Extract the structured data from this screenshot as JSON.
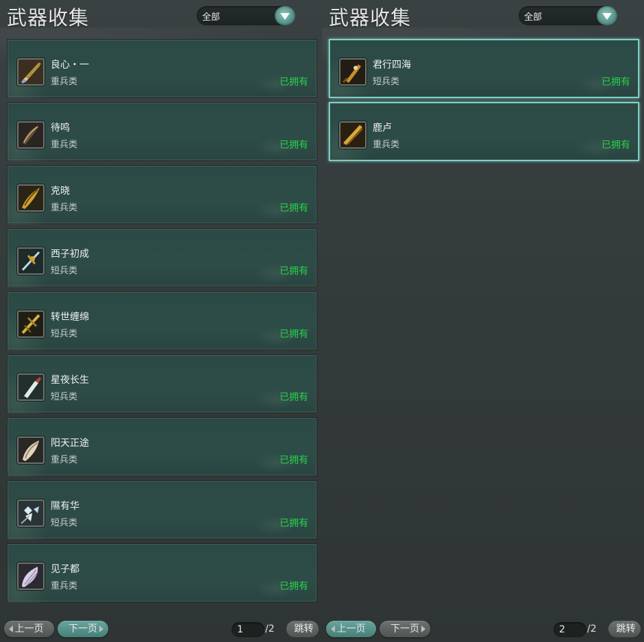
{
  "panels": [
    {
      "title": "武器收集",
      "filter": {
        "selected": "全部",
        "icon": "chevron-down-icon"
      },
      "items": [
        {
          "name": "良心・一",
          "type": "重兵类",
          "status": "已拥有",
          "icon": "weapon-icon"
        },
        {
          "name": "待鸣",
          "type": "重兵类",
          "status": "已拥有",
          "icon": "weapon-icon"
        },
        {
          "name": "克晓",
          "type": "重兵类",
          "status": "已拥有",
          "icon": "weapon-icon"
        },
        {
          "name": "西子初成",
          "type": "短兵类",
          "status": "已拥有",
          "icon": "weapon-icon"
        },
        {
          "name": "转世缠绵",
          "type": "短兵类",
          "status": "已拥有",
          "icon": "weapon-icon"
        },
        {
          "name": "星夜长生",
          "type": "短兵类",
          "status": "已拥有",
          "icon": "weapon-icon"
        },
        {
          "name": "阳天正途",
          "type": "重兵类",
          "status": "已拥有",
          "icon": "weapon-icon"
        },
        {
          "name": "隰有华",
          "type": "短兵类",
          "status": "已拥有",
          "icon": "weapon-icon"
        },
        {
          "name": "见子都",
          "type": "重兵类",
          "status": "已拥有",
          "icon": "weapon-icon"
        }
      ],
      "pagination": {
        "prev_label": "上一页",
        "next_label": "下一页",
        "current_page": "1",
        "total": "/2",
        "jump_label": "跳转"
      }
    },
    {
      "title": "武器收集",
      "filter": {
        "selected": "全部",
        "icon": "chevron-down-icon"
      },
      "items": [
        {
          "name": "君行四海",
          "type": "短兵类",
          "status": "已拥有",
          "icon": "weapon-icon"
        },
        {
          "name": "鹿卢",
          "type": "重兵类",
          "status": "已拥有",
          "icon": "weapon-icon"
        }
      ],
      "pagination": {
        "prev_label": "上一页",
        "next_label": "下一页",
        "current_page": "2",
        "total": "/2",
        "jump_label": "跳转"
      }
    }
  ],
  "colors": {
    "owned_status": "#27d24a",
    "card_bg": "#2c4a45",
    "selected_border": "#9ee6dc",
    "accent_button": "#5a958e"
  }
}
